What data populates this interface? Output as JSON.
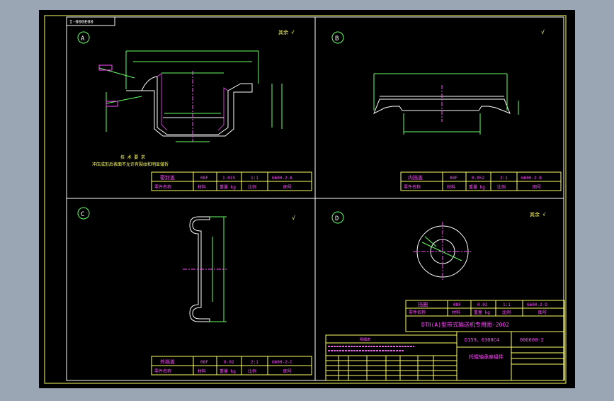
{
  "drawing": {
    "drawing_code_top": "I-000E00",
    "views": [
      {
        "id": "a",
        "label": "A",
        "finish_mark": "其余 √"
      },
      {
        "id": "b",
        "label": "B",
        "finish_mark": "√"
      },
      {
        "id": "c",
        "label": "C",
        "finish_mark": "√"
      },
      {
        "id": "d",
        "label": "D",
        "finish_mark": "其余 √"
      }
    ],
    "tech_requirements": {
      "title": "技 术 要 求",
      "line1": "冲压成形后表面不允许有裂纹和明显皱折"
    },
    "part_tables": {
      "a": {
        "name": "密封盖",
        "material": "08F",
        "weight": "1.015",
        "scale": "1:1",
        "drawing_no": "G600-2-A"
      },
      "b": {
        "name": "内挡盖",
        "material": "08F",
        "weight": "0.052",
        "scale": "2:1",
        "drawing_no": "G600-2-B"
      },
      "c": {
        "name": "外挡盖",
        "material": "08F",
        "weight": "0.02",
        "scale": "2:1",
        "drawing_no": "G600-2-C"
      },
      "d": {
        "name": "挡圈",
        "material": "08F",
        "weight": "0.02",
        "scale": "1:1",
        "drawing_no": "G600-2-D"
      }
    },
    "table_headers": {
      "part_name": "零件名称",
      "material": "材料",
      "weight": "重量 kg",
      "scale": "比例",
      "drawing_no": "图号"
    },
    "title_block": {
      "project": "DTⅡ(A)型带式输送机专用图-2002",
      "spec": "D159、6308C4",
      "code": "00G600-2",
      "assembly": "托辊轴承座组件"
    },
    "note_block": {
      "title": "明细表"
    }
  }
}
